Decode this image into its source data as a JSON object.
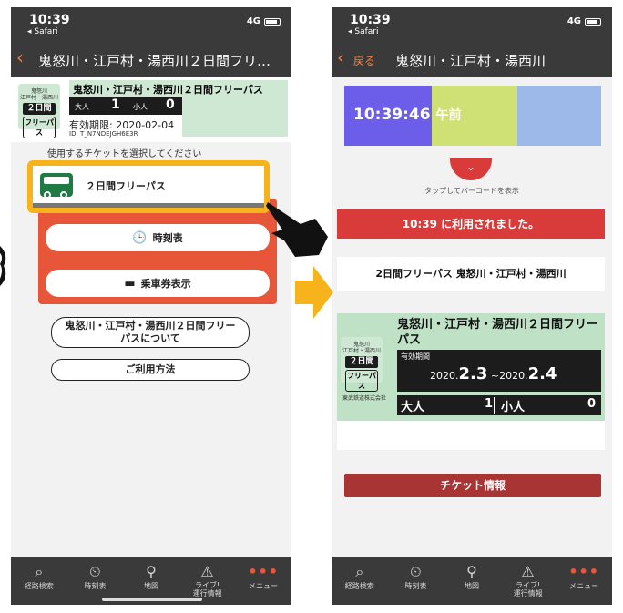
{
  "left": {
    "status": {
      "time": "10:39",
      "back_app": "◂ Safari",
      "signal": "4G"
    },
    "nav": {
      "title": "鬼怒川・江戸村・湯西川２日間フリ…"
    },
    "ticket": {
      "logo": {
        "line1": "鬼怒川\n江戸村・湯西川",
        "line2": "２日間",
        "line3": "フリーパス"
      },
      "title": "鬼怒川・江戸村・湯西川２日間フリーパス",
      "adult_label": "大人",
      "adult_count": "1",
      "child_label": "小人",
      "child_count": "0",
      "valid": "有効期限: 2020-02-04",
      "id": "ID: T_N7NDEJGH6E3R"
    },
    "select_text": "使用するチケットを選択してください",
    "pass_button": "２日間フリーパス",
    "timetable_button": "時刻表",
    "ticket_show_button": "乗車券表示",
    "about_button": "鬼怒川・江戸村・湯西川２日間フリー\nパスについて",
    "howto_button": "ご利用方法"
  },
  "right": {
    "status": {
      "time": "10:39",
      "back_app": "◂ Safari",
      "signal": "4G"
    },
    "nav": {
      "back": "戻る",
      "title": "鬼怒川・江戸村・湯西川"
    },
    "clock": "10:39:46",
    "am": "午前",
    "tap_text": "タップしてバーコードを表示",
    "used_banner": "10:39 に利用されました。",
    "route": "2日間フリーパス 鬼怒川・江戸村・湯西川",
    "ticket": {
      "logo": {
        "line1": "鬼怒川\n江戸村・湯西川",
        "line2": "２日間",
        "line3": "フリーパス"
      },
      "title": "鬼怒川・江戸村・湯西川２日間フリーパス",
      "valid_label": "有効期間",
      "date_from_prefix": "2020.",
      "date_from": "2.3",
      "sep": " ~",
      "date_to_prefix": "2020.",
      "date_to": "2.4",
      "adult_label": "大人",
      "adult_count": "1",
      "child_label": "小人",
      "child_count": "0",
      "company": "東武鉄道株式会社"
    },
    "info_button": "チケット情報"
  },
  "tabs": [
    {
      "icon": "search-icon",
      "label": "経路検索"
    },
    {
      "icon": "timetable-icon",
      "label": "時刻表"
    },
    {
      "icon": "map-pin-icon",
      "label": "地図"
    },
    {
      "icon": "live-info-icon",
      "label": "ライブ!\n運行情報"
    },
    {
      "icon": "menu-dots-icon",
      "label": "メニュー"
    }
  ],
  "colors": {
    "accent_orange": "#e8563a",
    "highlight_yellow": "#f6b31b",
    "used_red": "#d93a3a",
    "ticket_green": "#cfe8d4"
  }
}
